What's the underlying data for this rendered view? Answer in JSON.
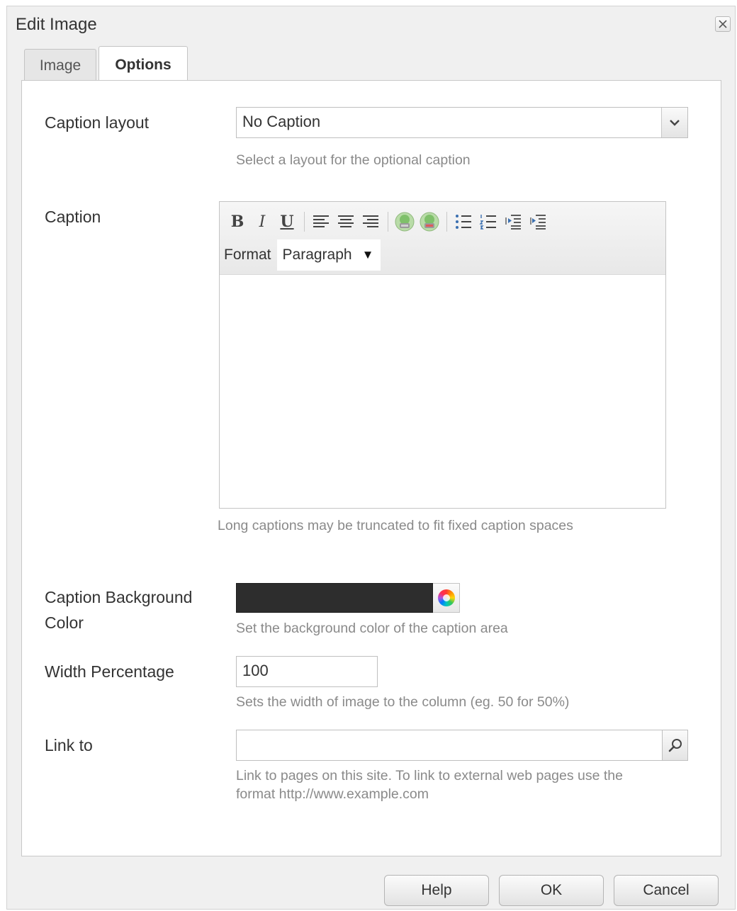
{
  "dialog": {
    "title": "Edit Image",
    "close_icon": "close-icon"
  },
  "tabs": [
    {
      "label": "Image",
      "active": false
    },
    {
      "label": "Options",
      "active": true
    }
  ],
  "form": {
    "caption_layout": {
      "label": "Caption layout",
      "value": "No Caption",
      "hint": "Select a layout for the optional caption"
    },
    "caption": {
      "label": "Caption",
      "toolbar": [
        "bold-icon",
        "italic-icon",
        "underline-icon",
        "align-left-icon",
        "align-center-icon",
        "align-right-icon",
        "link-icon",
        "unlink-icon",
        "bullet-list-icon",
        "numbered-list-icon",
        "outdent-icon",
        "indent-icon"
      ],
      "format_label": "Format",
      "format_value": "Paragraph",
      "hint": "Long captions may be truncated to fit fixed caption spaces"
    },
    "background_color": {
      "label_line1": "Caption Background",
      "label_line2": "Color",
      "value": "#2d2d2d",
      "hint": "Set the background color of the caption area"
    },
    "width_percentage": {
      "label": "Width Percentage",
      "value": "100",
      "hint": "Sets the width of image to the column (eg. 50 for 50%)"
    },
    "link_to": {
      "label": "Link to",
      "value": "",
      "hint_line1": "Link to pages on this site. To link to external web pages use the",
      "hint_line2": "format http://www.example.com"
    }
  },
  "footer": {
    "help": "Help",
    "ok": "OK",
    "cancel": "Cancel"
  }
}
